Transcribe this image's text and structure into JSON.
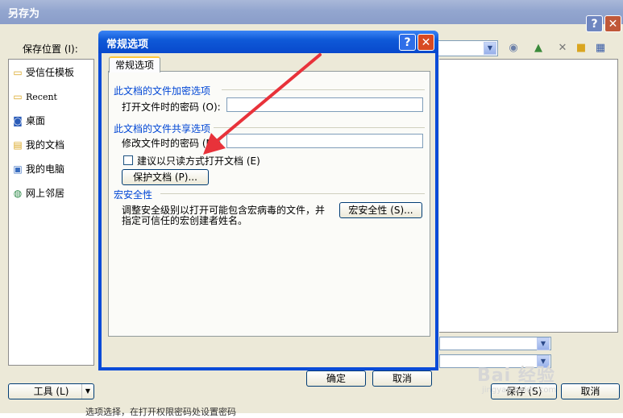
{
  "outer": {
    "title": "另存为",
    "help_glyph": "?",
    "close_glyph": "✕",
    "save_location_label": "保存位置 (I):",
    "places": [
      {
        "label": "受信任模板",
        "icon": "folder-icon"
      },
      {
        "label": "Recent",
        "icon": "folder-icon"
      },
      {
        "label": "桌面",
        "icon": "desktop-icon"
      },
      {
        "label": "我的文档",
        "icon": "documents-icon"
      },
      {
        "label": "我的电脑",
        "icon": "computer-icon"
      },
      {
        "label": "网上邻居",
        "icon": "network-icon"
      }
    ],
    "tools_label": "工具 (L)",
    "save_label": "保存 (S)",
    "cancel_label": "取消",
    "bottom_cut_text": "选项选择，在打开权限密码处设置密码"
  },
  "dialog": {
    "title": "常规选项",
    "help_glyph": "?",
    "close_glyph": "✕",
    "tab_label": "常规选项",
    "encryption_section": "此文档的文件加密选项",
    "open_password_label": "打开文件时的密码 (O):",
    "open_password_value": "",
    "sharing_section": "此文档的文件共享选项",
    "modify_password_label": "修改文件时的密码 (M):",
    "modify_password_value": "",
    "readonly_label": "建议以只读方式打开文档 (E)",
    "protect_button": "保护文档 (P)...",
    "macro_section": "宏安全性",
    "macro_desc_line1": "调整安全级别以打开可能包含宏病毒的文件，并",
    "macro_desc_line2": "指定可信任的宏创建者姓名。",
    "macro_button": "宏安全性 (S)...",
    "ok_label": "确定",
    "cancel_label": "取消"
  },
  "watermark": {
    "text": "Bai 经验",
    "sub": "jingyan.baidu.com"
  },
  "colors": {
    "annotation_arrow": "#e8323a",
    "xp_title_active": "#0a4bd8",
    "xp_title_inactive": "#93a6cf"
  }
}
